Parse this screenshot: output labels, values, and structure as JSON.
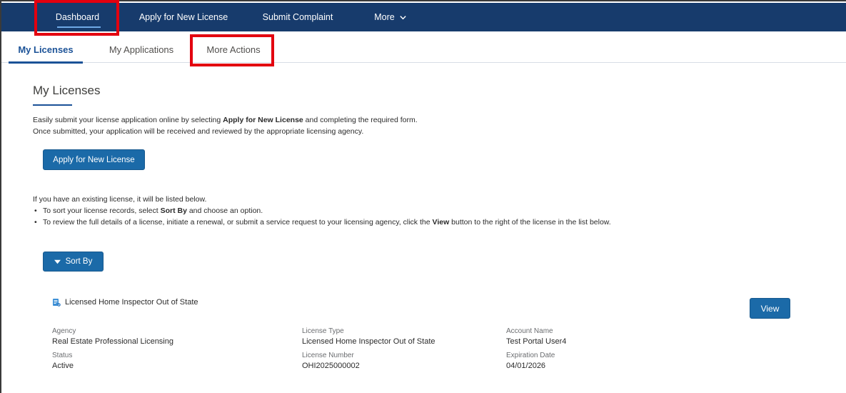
{
  "nav": {
    "dashboard": "Dashboard",
    "apply": "Apply for New License",
    "complaint": "Submit Complaint",
    "more": "More"
  },
  "tabs": {
    "licenses": "My Licenses",
    "applications": "My Applications",
    "more_actions": "More Actions"
  },
  "page": {
    "title": "My Licenses",
    "intro_line1_pre": "Easily submit your license application online by selecting ",
    "intro_line1_bold": "Apply for New License",
    "intro_line1_post": " and completing the required form.",
    "intro_line2": "Once submitted, your application will be received and reviewed by the appropriate licensing agency.",
    "apply_button": "Apply for New License",
    "existing_line": "If you have an existing license, it will be listed below.",
    "bullet1_pre": "To sort your license records, select ",
    "bullet1_bold": "Sort By",
    "bullet1_post": " and choose an option.",
    "bullet2_pre": "To review the full details of a license, initiate a renewal, or submit a service request to your licensing agency, click the ",
    "bullet2_bold": "View",
    "bullet2_post": " button to the right of the license in the list below.",
    "sort_button": "Sort By"
  },
  "license": {
    "title": "Licensed Home Inspector Out of State",
    "view_button": "View",
    "agency_label": "Agency",
    "agency": "Real Estate Professional Licensing",
    "status_label": "Status",
    "status": "Active",
    "type_label": "License Type",
    "type": "Licensed Home Inspector Out of State",
    "number_label": "License Number",
    "number": "OHI2025000002",
    "account_label": "Account Name",
    "account": "Test Portal User4",
    "expiration_label": "Expiration Date",
    "expiration": "04/01/2026"
  },
  "colors": {
    "nav_bg": "#173b6c",
    "accent": "#1b5297",
    "button": "#1b6aa8",
    "highlight": "#e3000f"
  },
  "icons": {
    "more": "chevron-down-icon",
    "sort": "caret-down-icon",
    "license": "license-record-icon"
  }
}
